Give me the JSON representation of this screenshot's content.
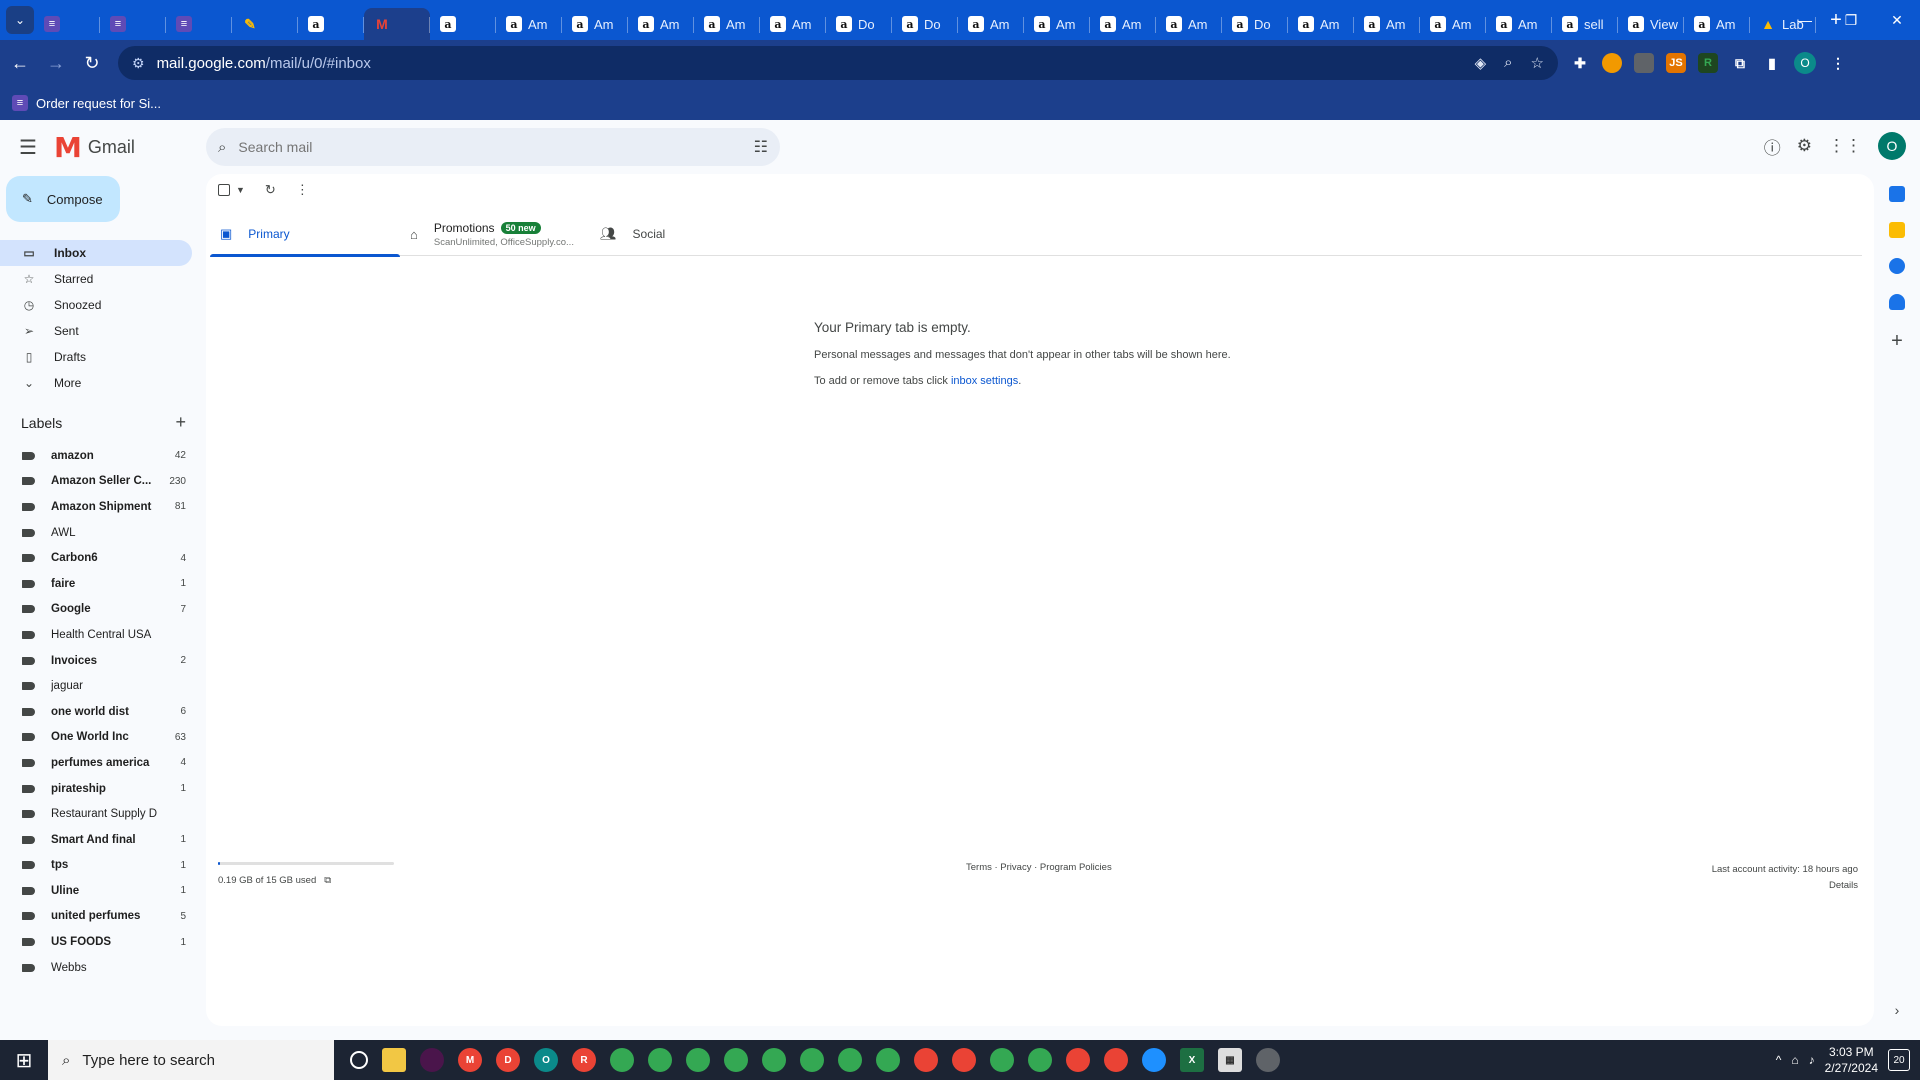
{
  "browser": {
    "tabs": [
      {
        "icon": "purple-sheet",
        "label": ""
      },
      {
        "icon": "purple-sheet",
        "label": ""
      },
      {
        "icon": "purple-sheet",
        "label": ""
      },
      {
        "icon": "pen",
        "label": ""
      },
      {
        "icon": "amazon",
        "label": ""
      },
      {
        "icon": "gmail",
        "label": "",
        "active": true
      },
      {
        "icon": "amazon",
        "label": ""
      },
      {
        "icon": "amazon",
        "label": "Am"
      },
      {
        "icon": "amazon",
        "label": "Am"
      },
      {
        "icon": "amazon",
        "label": "Am"
      },
      {
        "icon": "amazon",
        "label": "Am"
      },
      {
        "icon": "amazon",
        "label": "Am"
      },
      {
        "icon": "amazon",
        "label": "Do"
      },
      {
        "icon": "amazon",
        "label": "Do"
      },
      {
        "icon": "amazon",
        "label": "Am"
      },
      {
        "icon": "amazon",
        "label": "Am"
      },
      {
        "icon": "amazon",
        "label": "Am"
      },
      {
        "icon": "amazon",
        "label": "Am"
      },
      {
        "icon": "amazon",
        "label": "Do"
      },
      {
        "icon": "amazon",
        "label": "Am"
      },
      {
        "icon": "amazon",
        "label": "Am"
      },
      {
        "icon": "amazon",
        "label": "Am"
      },
      {
        "icon": "amazon",
        "label": "Am"
      },
      {
        "icon": "amazon",
        "label": "sell"
      },
      {
        "icon": "amazon",
        "label": "View"
      },
      {
        "icon": "amazon",
        "label": "Am"
      },
      {
        "icon": "drive",
        "label": "Lab"
      }
    ],
    "url_host": "mail.google.com",
    "url_path": "/mail/u/0/#inbox",
    "profile_initial": "O",
    "bookmark_label": "Order request for Si..."
  },
  "gmail": {
    "brand": "Gmail",
    "search_placeholder": "Search mail",
    "avatar_initial": "O",
    "compose_label": "Compose",
    "nav": [
      {
        "label": "Inbox",
        "icon": "inbox-icon",
        "glyph": "▭"
      },
      {
        "label": "Starred",
        "icon": "star-icon",
        "glyph": "☆"
      },
      {
        "label": "Snoozed",
        "icon": "clock-icon",
        "glyph": "◷"
      },
      {
        "label": "Sent",
        "icon": "send-icon",
        "glyph": "➢"
      },
      {
        "label": "Drafts",
        "icon": "draft-icon",
        "glyph": "▯"
      },
      {
        "label": "More",
        "icon": "chevron-down-icon",
        "glyph": "⌄"
      }
    ],
    "labels_title": "Labels",
    "labels": [
      {
        "name": "amazon",
        "count": "42",
        "bold": true
      },
      {
        "name": "Amazon Seller C...",
        "count": "230",
        "bold": true
      },
      {
        "name": "Amazon Shipment",
        "count": "81",
        "bold": true
      },
      {
        "name": "AWL",
        "count": "",
        "bold": false
      },
      {
        "name": "Carbon6",
        "count": "4",
        "bold": true
      },
      {
        "name": "faire",
        "count": "1",
        "bold": true
      },
      {
        "name": "Google",
        "count": "7",
        "bold": true
      },
      {
        "name": "Health Central USA",
        "count": "",
        "bold": false
      },
      {
        "name": "Invoices",
        "count": "2",
        "bold": true
      },
      {
        "name": "jaguar",
        "count": "",
        "bold": false
      },
      {
        "name": "one world dist",
        "count": "6",
        "bold": true
      },
      {
        "name": "One World Inc",
        "count": "63",
        "bold": true
      },
      {
        "name": "perfumes america",
        "count": "4",
        "bold": true
      },
      {
        "name": "pirateship",
        "count": "1",
        "bold": true
      },
      {
        "name": "Restaurant Supply D",
        "count": "",
        "bold": false
      },
      {
        "name": "Smart And final",
        "count": "1",
        "bold": true
      },
      {
        "name": "tps",
        "count": "1",
        "bold": true
      },
      {
        "name": "Uline",
        "count": "1",
        "bold": true
      },
      {
        "name": "united perfumes",
        "count": "5",
        "bold": true
      },
      {
        "name": "US FOODS",
        "count": "1",
        "bold": true
      },
      {
        "name": "Webbs",
        "count": "",
        "bold": false
      }
    ],
    "tabs": {
      "primary": "Primary",
      "promotions": "Promotions",
      "promotions_badge": "50 new",
      "promotions_sub": "ScanUnlimited, OfficeSupply.co...",
      "social": "Social"
    },
    "empty": {
      "title": "Your Primary tab is empty.",
      "line1": "Personal messages and messages that don't appear in other tabs will be shown here.",
      "line2_prefix": "To add or remove tabs click ",
      "line2_link": "inbox settings",
      "line2_suffix": "."
    },
    "footer": {
      "storage": "0.19 GB of 15 GB used",
      "storage_fraction": 0.013,
      "links": "Terms · Privacy · Program Policies",
      "activity": "Last account activity: 18 hours ago",
      "details": "Details"
    }
  },
  "taskbar": {
    "search_placeholder": "Type here to search",
    "time": "3:03 PM",
    "date": "2/27/2024",
    "notifications": "20"
  },
  "colors": {
    "chrome_blue": "#0b57d0",
    "compose_bg": "#c2e7ff",
    "active_nav": "#d3e3fd",
    "badge_green": "#188038"
  }
}
